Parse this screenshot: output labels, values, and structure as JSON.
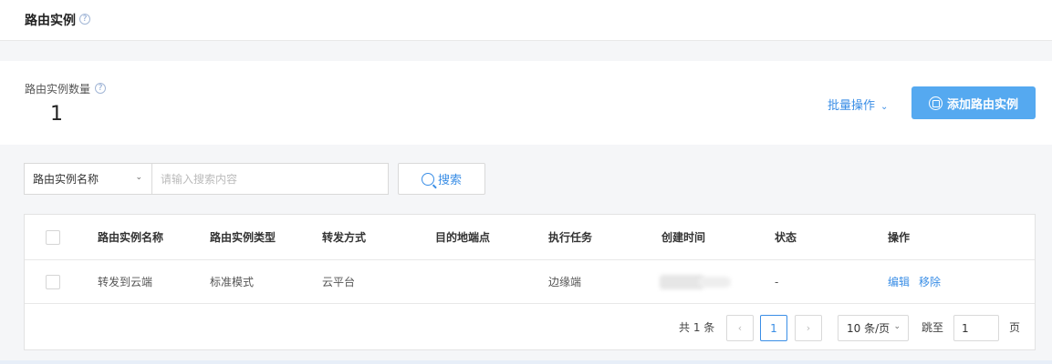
{
  "header": {
    "title": "路由实例",
    "help_icon": "?"
  },
  "stats": {
    "label": "路由实例数量",
    "help_icon": "?",
    "value": "1"
  },
  "actions": {
    "batch_label": "批量操作",
    "add_label": "添加路由实例",
    "accent_color": "#55a9f0"
  },
  "search": {
    "field_selected": "路由实例名称",
    "placeholder": "请输入搜索内容",
    "button_label": "搜索"
  },
  "table": {
    "columns": [
      "路由实例名称",
      "路由实例类型",
      "转发方式",
      "目的地端点",
      "执行任务",
      "创建时间",
      "状态",
      "操作"
    ],
    "rows": [
      {
        "name": "转发到云端",
        "type": "标准模式",
        "forward": "云平台",
        "destination": "",
        "task": "边缘端",
        "status": "-",
        "actions": [
          "编辑",
          "移除"
        ]
      }
    ]
  },
  "pagination": {
    "total_text": "共 1 条",
    "prev": "‹",
    "current_page": "1",
    "next": "›",
    "page_size": "10 条/页",
    "jump_label": "跳至",
    "jump_value": "1",
    "page_unit": "页"
  }
}
